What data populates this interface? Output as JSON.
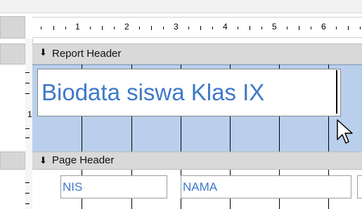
{
  "ruler": {
    "numbers": [
      "1",
      "2",
      "3",
      "4",
      "5",
      "6"
    ]
  },
  "left_ruler": {
    "number": "1"
  },
  "sections": {
    "report_header": {
      "label": "Report Header",
      "icon": "section-collapse-icon"
    },
    "page_header": {
      "label": "Page Header",
      "icon": "section-collapse-icon"
    }
  },
  "report_header": {
    "title_text": "Biodata siswa Klas IX"
  },
  "page_header": {
    "fields": [
      "NIS",
      "NAMA"
    ]
  },
  "colors": {
    "grid_background": "#b9cfec",
    "text_accent": "#3f79c8",
    "section_bar": "#d9d9d9"
  }
}
